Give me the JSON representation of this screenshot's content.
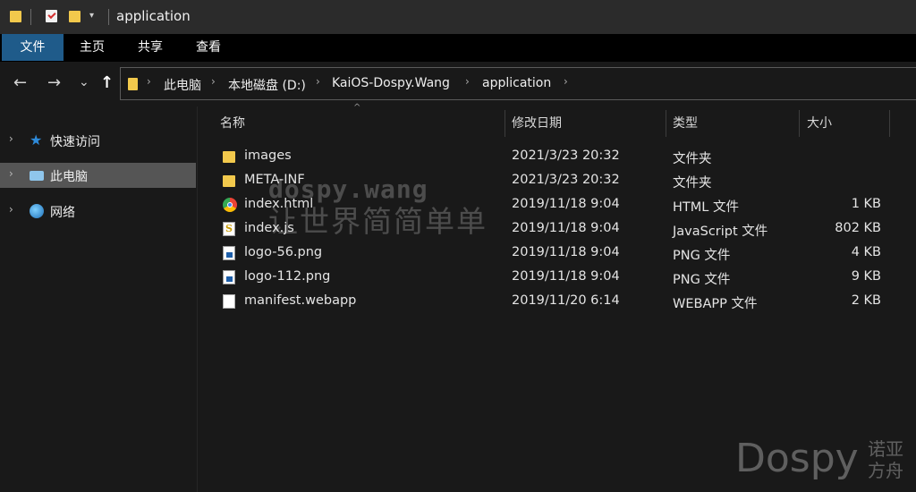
{
  "window": {
    "title": "application",
    "qa_dropdown": "▾"
  },
  "ribbon": {
    "tabs": [
      {
        "label": "文件",
        "active": true
      },
      {
        "label": "主页"
      },
      {
        "label": "共享"
      },
      {
        "label": "查看"
      }
    ]
  },
  "nav": {
    "back": "←",
    "forward": "→",
    "recent": "⌄",
    "up": "↑",
    "separator": "›"
  },
  "address": {
    "crumbs": [
      "此电脑",
      "本地磁盘 (D:)",
      "KaiOS-Dospy.Wang",
      "application"
    ]
  },
  "sidebar": {
    "items": [
      {
        "label": "快速访问",
        "icon": "star-icon"
      },
      {
        "label": "此电脑",
        "icon": "pc-icon",
        "selected": true
      },
      {
        "label": "网络",
        "icon": "globe-icon"
      }
    ],
    "expand": "›"
  },
  "columns": {
    "name": "名称",
    "date": "修改日期",
    "type": "类型",
    "size": "大小",
    "sort_arrow": "^"
  },
  "files": [
    {
      "name": "images",
      "date": "2021/3/23 20:32",
      "type": "文件夹",
      "size": "",
      "icon": "folder-icon"
    },
    {
      "name": "META-INF",
      "date": "2021/3/23 20:32",
      "type": "文件夹",
      "size": "",
      "icon": "folder-icon"
    },
    {
      "name": "index.html",
      "date": "2019/11/18 9:04",
      "type": "HTML 文件",
      "size": "1 KB",
      "icon": "chrome-icon"
    },
    {
      "name": "index.js",
      "date": "2019/11/18 9:04",
      "type": "JavaScript 文件",
      "size": "802 KB",
      "icon": "js-icon"
    },
    {
      "name": "logo-56.png",
      "date": "2019/11/18 9:04",
      "type": "PNG 文件",
      "size": "4 KB",
      "icon": "png-icon"
    },
    {
      "name": "logo-112.png",
      "date": "2019/11/18 9:04",
      "type": "PNG 文件",
      "size": "9 KB",
      "icon": "png-icon"
    },
    {
      "name": "manifest.webapp",
      "date": "2019/11/20 6:14",
      "type": "WEBAPP 文件",
      "size": "2 KB",
      "icon": "file-icon"
    }
  ],
  "watermark": {
    "line1": "dospy.wang",
    "line2": "让世界简简单单"
  },
  "logo": {
    "text": "Dospy",
    "cn": "诺亚方舟"
  }
}
